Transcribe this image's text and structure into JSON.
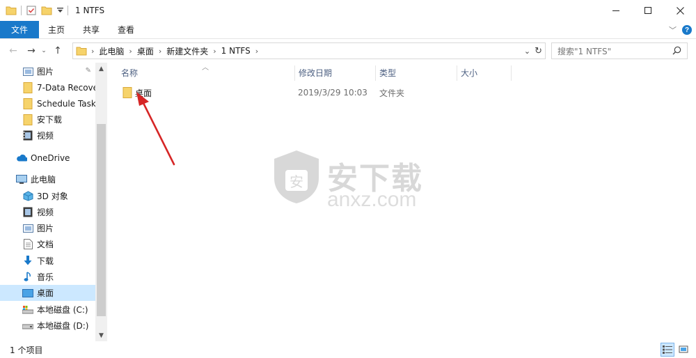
{
  "window": {
    "title": "1 NTFS",
    "minimize_icon": "minimize-icon",
    "maximize_icon": "maximize-icon",
    "close_icon": "close-icon"
  },
  "ribbon": {
    "tabs": [
      {
        "label": "文件"
      },
      {
        "label": "主页"
      },
      {
        "label": "共享"
      },
      {
        "label": "查看"
      }
    ]
  },
  "address": {
    "breadcrumbs": [
      {
        "label": "此电脑"
      },
      {
        "label": "桌面"
      },
      {
        "label": "新建文件夹"
      },
      {
        "label": "1 NTFS"
      }
    ]
  },
  "search": {
    "placeholder": "搜索\"1 NTFS\""
  },
  "sidebar": {
    "items": [
      {
        "label": "图片",
        "icon": "pictures-icon",
        "pinned": true
      },
      {
        "label": "7-Data Recove",
        "icon": "folder-icon"
      },
      {
        "label": "Schedule Task",
        "icon": "folder-icon"
      },
      {
        "label": "安下载",
        "icon": "folder-icon"
      },
      {
        "label": "视频",
        "icon": "videos-icon"
      },
      {
        "label": "OneDrive",
        "icon": "onedrive-icon"
      },
      {
        "label": "此电脑",
        "icon": "this-pc-icon"
      },
      {
        "label": "3D 对象",
        "icon": "3d-objects-icon"
      },
      {
        "label": "视频",
        "icon": "videos-icon"
      },
      {
        "label": "图片",
        "icon": "pictures-icon"
      },
      {
        "label": "文档",
        "icon": "documents-icon"
      },
      {
        "label": "下载",
        "icon": "downloads-icon"
      },
      {
        "label": "音乐",
        "icon": "music-icon"
      },
      {
        "label": "桌面",
        "icon": "desktop-icon",
        "selected": true
      },
      {
        "label": "本地磁盘 (C:)",
        "icon": "drive-c-icon"
      },
      {
        "label": "本地磁盘 (D:)",
        "icon": "drive-d-icon"
      }
    ]
  },
  "columns": [
    {
      "label": "名称"
    },
    {
      "label": "修改日期"
    },
    {
      "label": "类型"
    },
    {
      "label": "大小"
    }
  ],
  "files": [
    {
      "name": "桌面",
      "modified": "2019/3/29 10:03",
      "type": "文件夹",
      "size": ""
    }
  ],
  "watermark": {
    "cn": "安下载",
    "en": "anxz.com"
  },
  "status": {
    "count": "1 个项目"
  },
  "colors": {
    "accent": "#1979ca",
    "selection": "#cce8ff",
    "folder": "#f6d36b",
    "annotation": "#d62626"
  }
}
